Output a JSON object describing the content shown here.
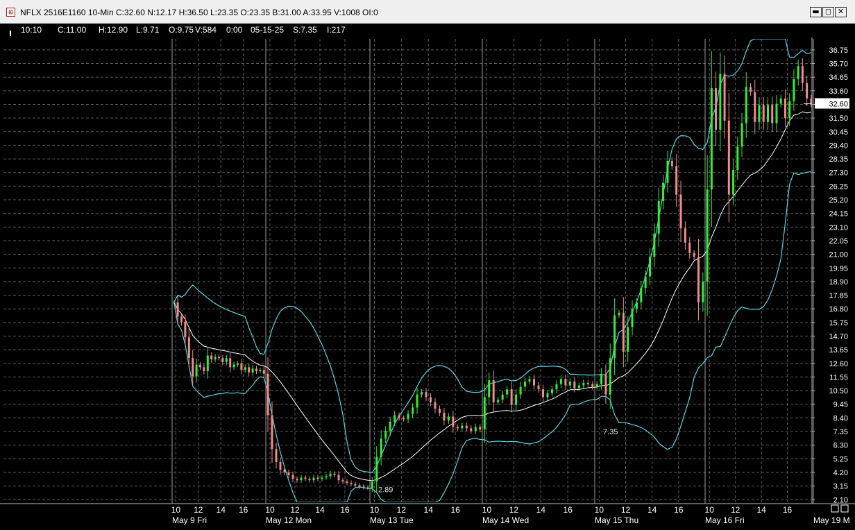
{
  "window": {
    "title": "NFLX 2516E1160 10-Min C:32.60 N:12.17 H:36.50 L:23.35 O:23.35 B:31.00 A:33.95 V:1008 OI:0",
    "icon": "chart-app-icon",
    "buttons": {
      "minimize": "▬",
      "maximize": "◻",
      "close": "✕"
    }
  },
  "infobar": {
    "time": "10:10",
    "close": "C:11.00",
    "high": "H:12.90",
    "low": "L:9.71",
    "open": "O:9.75",
    "volume": "V:584",
    "change": "0:00",
    "date": "05-15-25",
    "strike": "S:7.35",
    "interest": "I:217"
  },
  "colors": {
    "background": "#000000",
    "up_candle": "#33ee33",
    "down_candle": "#f08c8c",
    "bands": "#55d8e8",
    "average": "#ffffff",
    "grid": "#5a5a5a",
    "price_tag": "#ffffff"
  },
  "chart_data": {
    "type": "candlestick",
    "title": "",
    "y_ticks": [
      "36.75",
      "35.70",
      "34.65",
      "33.60",
      "32.55",
      "31.50",
      "30.45",
      "29.40",
      "28.35",
      "27.30",
      "26.25",
      "25.20",
      "24.15",
      "23.10",
      "22.05",
      "21.00",
      "19.95",
      "18.90",
      "17.85",
      "16.80",
      "15.75",
      "14.70",
      "13.65",
      "12.60",
      "11.55",
      "10.50",
      "9.45",
      "8.40",
      "7.35",
      "6.30",
      "5.25",
      "4.20",
      "3.15",
      "2.10"
    ],
    "ylim": [
      1.9,
      37.6
    ],
    "last_price": "32.60",
    "x_hour_ticks": [
      "10",
      "12",
      "14",
      "16",
      "10",
      "12",
      "14",
      "16",
      "10",
      "12",
      "14",
      "16",
      "10",
      "12",
      "14",
      "16",
      "10",
      "12",
      "14",
      "16",
      "10",
      "12",
      "14",
      "16"
    ],
    "x_day_labels": [
      "May 9 Fri",
      "May 12 Mon",
      "May 13 Tue",
      "May 14 Wed",
      "May 15 Thu",
      "May 16 Fri",
      "May 19 M"
    ],
    "annotations": [
      {
        "text": "2.89",
        "x_day": 2,
        "y": 2.89
      },
      {
        "text": "7.35",
        "x_day": 4,
        "y": 7.35
      }
    ],
    "days": [
      {
        "label": "May 9 Fri",
        "closes": [
          17.3,
          16.2,
          15.8,
          14.6,
          13.0,
          11.6,
          12.5,
          12.3,
          12.0,
          13.2,
          12.9,
          13.1,
          13.0,
          12.7,
          13.0,
          12.3,
          12.5,
          12.6,
          12.1,
          12.3,
          11.9,
          12.2,
          12.0,
          12.1,
          11.8
        ]
      },
      {
        "label": "May 12 Mon",
        "closes": [
          8.6,
          6.0,
          5.0,
          4.4,
          4.2,
          4.0,
          3.7,
          3.6,
          3.8,
          3.7,
          3.6,
          3.8,
          3.7,
          3.8,
          3.9,
          4.1,
          4.0,
          3.6,
          3.5,
          3.4,
          3.3,
          3.2,
          3.1,
          3.05,
          3.0
        ]
      },
      {
        "label": "May 13 Tue",
        "closes": [
          3.5,
          5.4,
          6.8,
          7.4,
          8.1,
          8.6,
          8.4,
          8.3,
          8.7,
          9.2,
          10.2,
          10.4,
          10.0,
          9.6,
          9.1,
          8.8,
          8.2,
          8.5,
          7.7,
          7.6,
          7.8,
          7.6,
          7.4,
          7.7,
          7.5
        ]
      },
      {
        "label": "May 14 Wed",
        "closes": [
          10.0,
          11.3,
          9.6,
          9.8,
          10.2,
          10.6,
          9.4,
          10.2,
          10.8,
          11.2,
          11.4,
          10.9,
          10.6,
          10.0,
          10.3,
          10.6,
          11.0,
          11.4,
          10.9,
          11.2,
          10.7,
          10.9,
          11.1,
          11.0,
          10.8
        ]
      },
      {
        "label": "May 15 Thu",
        "closes": [
          11.0,
          11.8,
          10.2,
          13.0,
          16.3,
          16.5,
          13.5,
          15.4,
          16.8,
          17.3,
          18.4,
          19.3,
          20.8,
          22.6,
          25.1,
          26.5,
          28.2,
          27.8,
          25.6,
          23.0,
          21.9,
          21.1,
          20.8,
          17.3,
          18.9
        ]
      },
      {
        "label": "May 16 Fri",
        "closes": [
          26.0,
          33.8,
          30.6,
          34.9,
          31.3,
          25.6,
          27.5,
          29.3,
          31.1,
          33.9,
          33.5,
          31.2,
          32.5,
          31.2,
          32.5,
          31.1,
          32.6,
          33.0,
          31.5,
          32.8,
          34.5,
          35.5,
          34.2,
          33.0,
          32.6
        ]
      }
    ]
  }
}
